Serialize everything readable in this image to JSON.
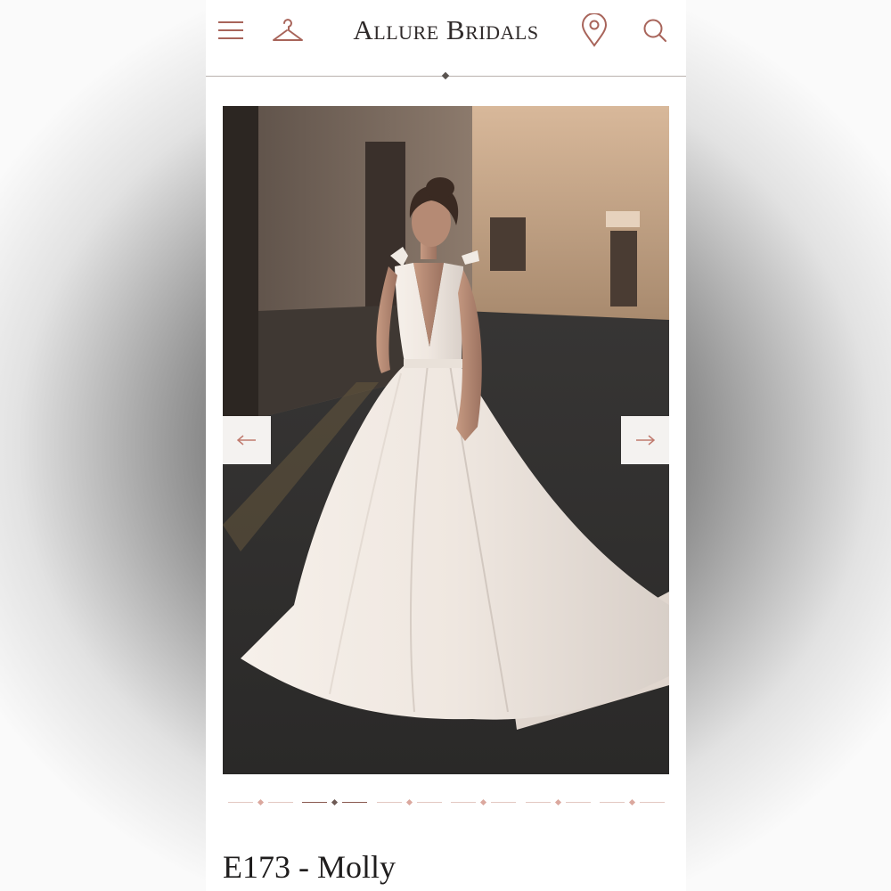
{
  "header": {
    "brand": "Allure Bridals",
    "icons": [
      "menu-icon",
      "hanger-icon",
      "location-pin-icon",
      "search-icon"
    ]
  },
  "gallery": {
    "prev_icon": "arrow-left-icon",
    "next_icon": "arrow-right-icon",
    "slide_count": 6,
    "active_slide": 2
  },
  "product": {
    "title": "E173 - Molly"
  },
  "colors": {
    "accent": "#a8645a",
    "text": "#1f1d1d"
  }
}
